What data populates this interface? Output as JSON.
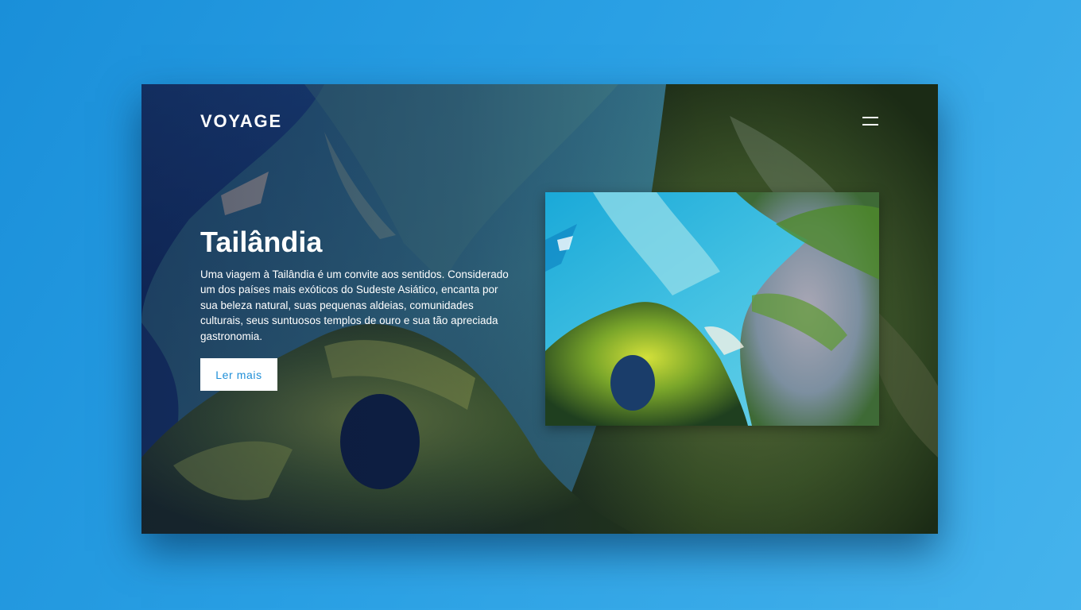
{
  "brand": {
    "logo": "VOYAGE"
  },
  "header": {
    "menu_icon": "hamburger-icon"
  },
  "hero": {
    "title": "Tailândia",
    "description": "Uma viagem à Tailândia é um convite aos sentidos. Considerado um dos países mais exóticos do Sudeste Asiático, encanta por sua beleza natural, suas pequenas aldeias, comunidades culturais, seus suntuosos templos de ouro e sua tão apreciada gastronomia.",
    "cta_label": "Ler mais"
  },
  "colors": {
    "page_background": "#2aa0e4",
    "button_text": "#1f8fd8",
    "button_background": "#ffffff",
    "text": "#ffffff"
  }
}
